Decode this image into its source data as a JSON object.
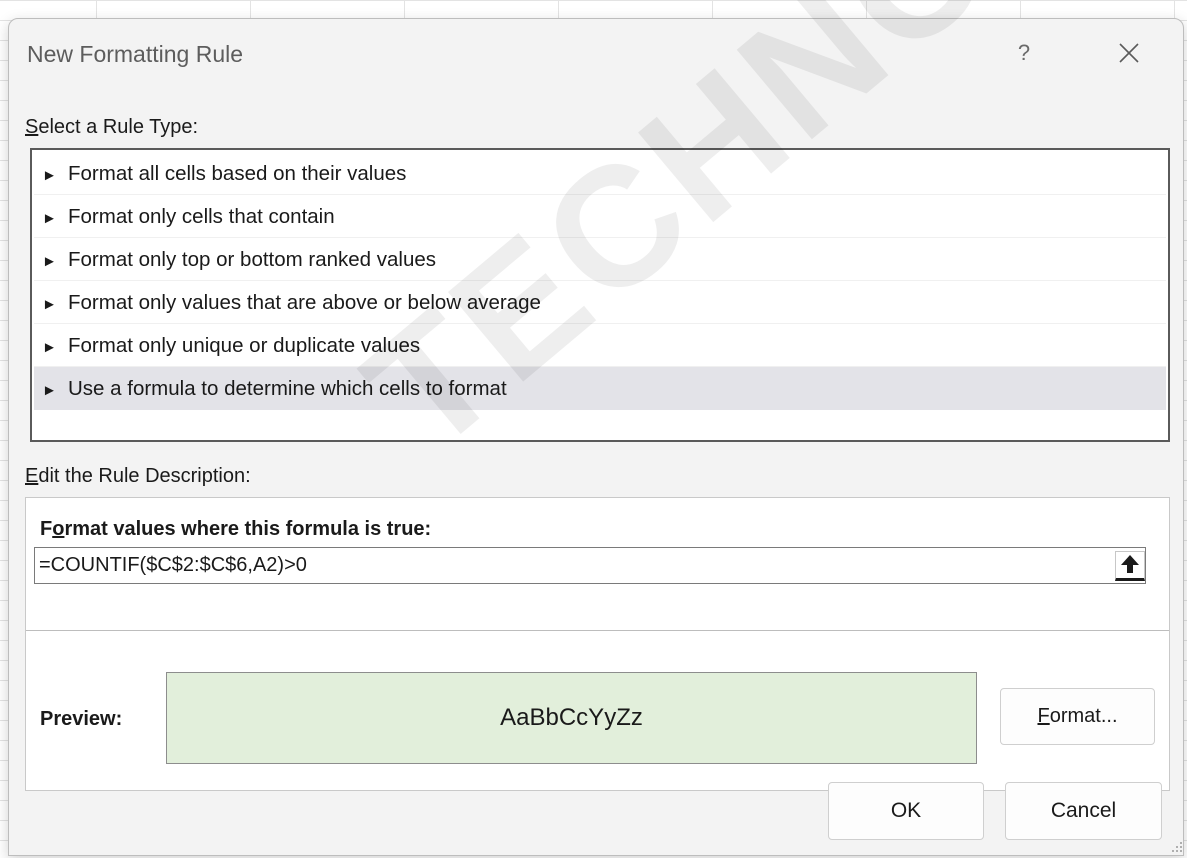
{
  "dialog": {
    "title": "New Formatting Rule",
    "help_label": "?",
    "close_icon": "close-icon"
  },
  "rule_type": {
    "label_underlined": "S",
    "label_rest": "elect a Rule Type:",
    "items": [
      {
        "label": "Format all cells based on their values",
        "selected": false
      },
      {
        "label": "Format only cells that contain",
        "selected": false
      },
      {
        "label": "Format only top or bottom ranked values",
        "selected": false
      },
      {
        "label": "Format only values that are above or below average",
        "selected": false
      },
      {
        "label": "Format only unique or duplicate values",
        "selected": false
      },
      {
        "label": "Use a formula to determine which cells to format",
        "selected": true
      }
    ],
    "item_glyph": "►"
  },
  "description": {
    "label_underlined": "E",
    "label_rest": "dit the Rule Description:",
    "formula_label_pre": "F",
    "formula_label_underlined": "o",
    "formula_label_rest": "rmat values where this formula is true:",
    "formula_value": "=COUNTIF($C$2:$C$6,A2)>0",
    "collapse_icon": "collapse-range-icon",
    "preview_label": "Preview:",
    "preview_sample": "AaBbCcYyZz",
    "preview_fill_color": "#e2efdb",
    "format_button_underlined": "F",
    "format_button_rest": "ormat..."
  },
  "footer": {
    "ok_label": "OK",
    "cancel_label": "Cancel"
  },
  "watermark": "TECHNOLOGY.COM"
}
